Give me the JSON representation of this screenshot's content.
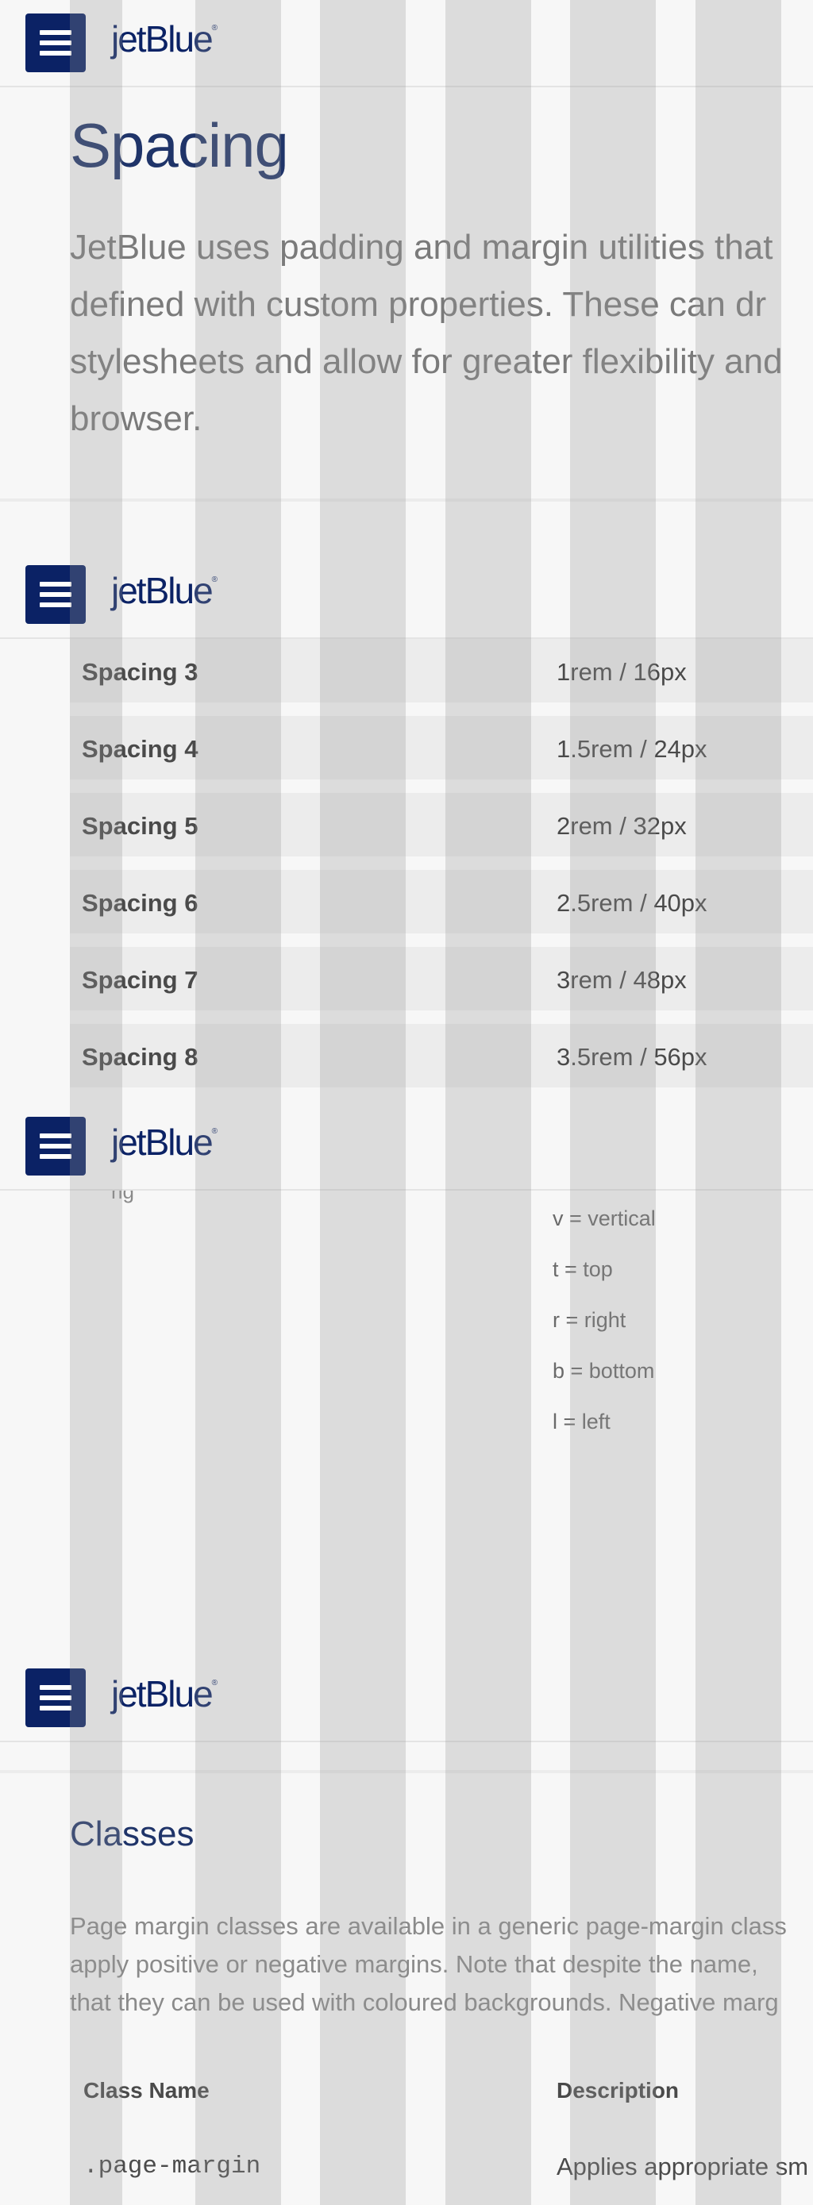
{
  "brand": {
    "logo_text": "jetBlue",
    "logo_mark": "®",
    "primary_color": "#0b2265"
  },
  "menu": {
    "icon": "hamburger-menu-icon"
  },
  "page": {
    "title": "Spacing",
    "intro_lines": [
      "JetBlue uses padding and margin utilities that",
      "defined with custom properties. These can dr",
      "stylesheets and allow for greater flexibility and",
      "browser."
    ]
  },
  "spacing_table": {
    "rows": [
      {
        "name": "Spacing 3",
        "value": "1rem / 16px"
      },
      {
        "name": "Spacing 4",
        "value": "1.5rem / 24px"
      },
      {
        "name": "Spacing 5",
        "value": "2rem / 32px"
      },
      {
        "name": "Spacing 6",
        "value": "2.5rem / 40px"
      },
      {
        "name": "Spacing 7",
        "value": "3rem / 48px"
      },
      {
        "name": "Spacing 8",
        "value": "3.5rem / 56px"
      }
    ]
  },
  "abbreviations": {
    "partial_text": "ng",
    "items": [
      "v = vertical",
      "t = top",
      "r = right",
      "b = bottom",
      "l = left"
    ]
  },
  "classes": {
    "title": "Classes",
    "desc_lines": [
      "Page margin classes are available in a generic page-margin class",
      "apply positive or negative margins. Note that despite the name,",
      "that they can be used with coloured backgrounds. Negative marg"
    ],
    "table": {
      "headers": [
        "Class Name",
        "Description"
      ],
      "rows": [
        {
          "class_name": ".page-margin",
          "description": "Applies appropriate sm"
        }
      ]
    }
  }
}
